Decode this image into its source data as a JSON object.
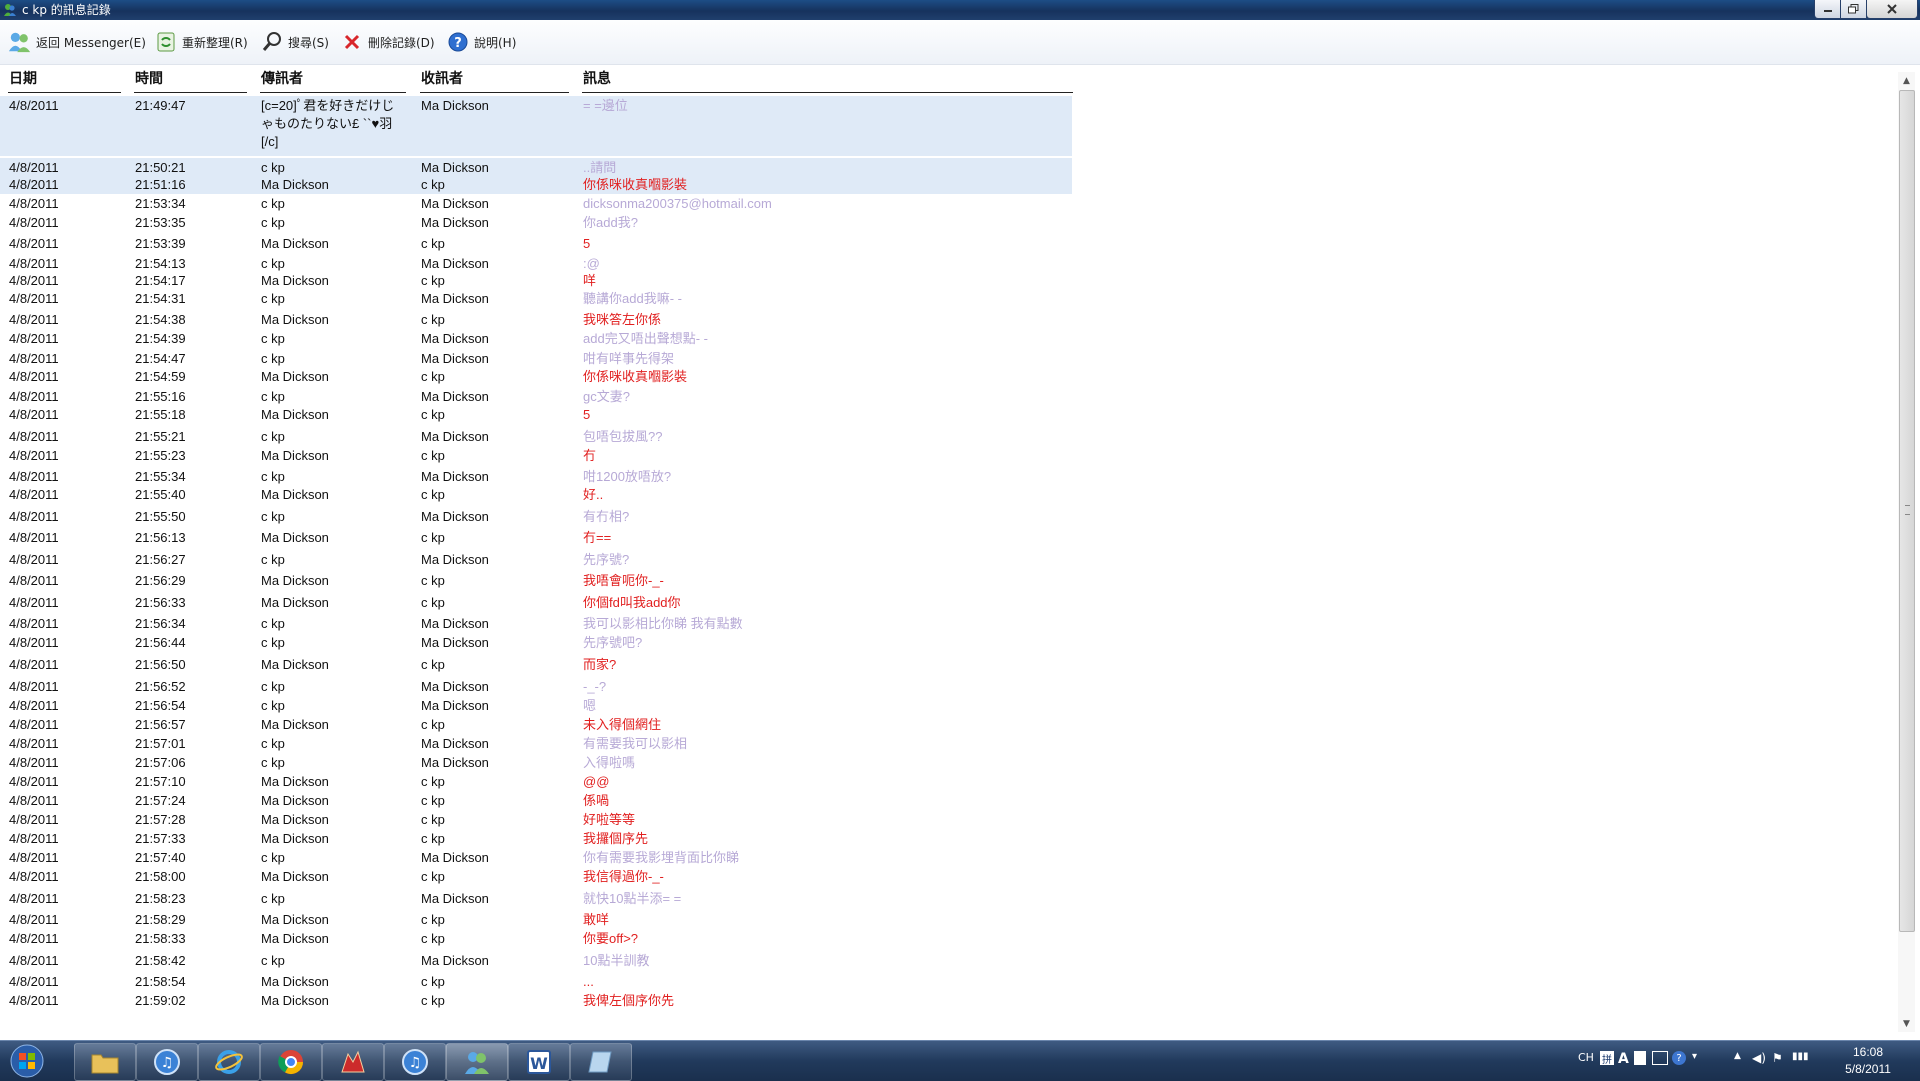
{
  "window": {
    "title": "c kp 的訊息記錄"
  },
  "toolbar": {
    "back_label": "返回 Messenger(E)",
    "refresh_label": "重新整理(R)",
    "search_label": "搜尋(S)",
    "delete_label": "刪除記錄(D)",
    "help_label": "說明(H)"
  },
  "columns": [
    "日期",
    "時間",
    "傳訊者",
    "收訊者",
    "訊息"
  ],
  "rows": [
    {
      "date": "4/8/2011",
      "time": "21:49:47",
      "from": "[c=20]ﾟ君を好きだけじゃものたりない£ ``♥羽[/c]",
      "to": "Ma Dickson",
      "msg": "= =邊位",
      "sel": true
    },
    {
      "date": "4/8/2011",
      "time": "21:50:21",
      "from": "c kp",
      "to": "Ma Dickson",
      "msg": "..請問",
      "sel": true
    },
    {
      "date": "4/8/2011",
      "time": "21:51:16",
      "from": "Ma Dickson",
      "to": "c kp",
      "msg": "你係咪收真嗰影裝",
      "sel": true
    },
    {
      "date": "4/8/2011",
      "time": "21:53:34",
      "from": "c kp",
      "to": "Ma Dickson",
      "msg": "dicksonma200375@hotmail.com"
    },
    {
      "date": "4/8/2011",
      "time": "21:53:35",
      "from": "c kp",
      "to": "Ma Dickson",
      "msg": "你add我?"
    },
    {
      "date": "4/8/2011",
      "time": "21:53:39",
      "from": "Ma Dickson",
      "to": "c kp",
      "msg": "5"
    },
    {
      "date": "4/8/2011",
      "time": "21:54:13",
      "from": "c kp",
      "to": "Ma Dickson",
      "msg": ":@"
    },
    {
      "date": "4/8/2011",
      "time": "21:54:17",
      "from": "Ma Dickson",
      "to": "c kp",
      "msg": "咩"
    },
    {
      "date": "4/8/2011",
      "time": "21:54:31",
      "from": "c kp",
      "to": "Ma Dickson",
      "msg": "聽講你add我嘛- -"
    },
    {
      "date": "4/8/2011",
      "time": "21:54:38",
      "from": "Ma Dickson",
      "to": "c kp",
      "msg": "我咪答左你係"
    },
    {
      "date": "4/8/2011",
      "time": "21:54:39",
      "from": "c kp",
      "to": "Ma Dickson",
      "msg": "add完又唔出聲想點- -"
    },
    {
      "date": "4/8/2011",
      "time": "21:54:47",
      "from": "c kp",
      "to": "Ma Dickson",
      "msg": "咁有咩事先得架"
    },
    {
      "date": "4/8/2011",
      "time": "21:54:59",
      "from": "Ma Dickson",
      "to": "c kp",
      "msg": "你係咪收真嗰影裝"
    },
    {
      "date": "4/8/2011",
      "time": "21:55:16",
      "from": "c kp",
      "to": "Ma Dickson",
      "msg": "gc文妻?"
    },
    {
      "date": "4/8/2011",
      "time": "21:55:18",
      "from": "Ma Dickson",
      "to": "c kp",
      "msg": "5"
    },
    {
      "date": "4/8/2011",
      "time": "21:55:21",
      "from": "c kp",
      "to": "Ma Dickson",
      "msg": "包唔包拔風??"
    },
    {
      "date": "4/8/2011",
      "time": "21:55:23",
      "from": "Ma Dickson",
      "to": "c kp",
      "msg": "冇"
    },
    {
      "date": "4/8/2011",
      "time": "21:55:34",
      "from": "c kp",
      "to": "Ma Dickson",
      "msg": "咁1200放唔放?"
    },
    {
      "date": "4/8/2011",
      "time": "21:55:40",
      "from": "Ma Dickson",
      "to": "c kp",
      "msg": "好.."
    },
    {
      "date": "4/8/2011",
      "time": "21:55:50",
      "from": "c kp",
      "to": "Ma Dickson",
      "msg": "有冇相?"
    },
    {
      "date": "4/8/2011",
      "time": "21:56:13",
      "from": "Ma Dickson",
      "to": "c kp",
      "msg": "冇=="
    },
    {
      "date": "4/8/2011",
      "time": "21:56:27",
      "from": "c kp",
      "to": "Ma Dickson",
      "msg": "先序號?"
    },
    {
      "date": "4/8/2011",
      "time": "21:56:29",
      "from": "Ma Dickson",
      "to": "c kp",
      "msg": "我唔會呃你-_-"
    },
    {
      "date": "4/8/2011",
      "time": "21:56:33",
      "from": "Ma Dickson",
      "to": "c kp",
      "msg": "你個fd叫我add你"
    },
    {
      "date": "4/8/2011",
      "time": "21:56:34",
      "from": "c kp",
      "to": "Ma Dickson",
      "msg": "我可以影相比你睇 我有點數"
    },
    {
      "date": "4/8/2011",
      "time": "21:56:44",
      "from": "c kp",
      "to": "Ma Dickson",
      "msg": "先序號吧?"
    },
    {
      "date": "4/8/2011",
      "time": "21:56:50",
      "from": "Ma Dickson",
      "to": "c kp",
      "msg": "而家?"
    },
    {
      "date": "4/8/2011",
      "time": "21:56:52",
      "from": "c kp",
      "to": "Ma Dickson",
      "msg": "-_-?"
    },
    {
      "date": "4/8/2011",
      "time": "21:56:54",
      "from": "c kp",
      "to": "Ma Dickson",
      "msg": "嗯"
    },
    {
      "date": "4/8/2011",
      "time": "21:56:57",
      "from": "Ma Dickson",
      "to": "c kp",
      "msg": "未入得個網住"
    },
    {
      "date": "4/8/2011",
      "time": "21:57:01",
      "from": "c kp",
      "to": "Ma Dickson",
      "msg": "有需要我可以影相"
    },
    {
      "date": "4/8/2011",
      "time": "21:57:06",
      "from": "c kp",
      "to": "Ma Dickson",
      "msg": "入得啦嗎"
    },
    {
      "date": "4/8/2011",
      "time": "21:57:10",
      "from": "Ma Dickson",
      "to": "c kp",
      "msg": "@@"
    },
    {
      "date": "4/8/2011",
      "time": "21:57:24",
      "from": "Ma Dickson",
      "to": "c kp",
      "msg": "係喎"
    },
    {
      "date": "4/8/2011",
      "time": "21:57:28",
      "from": "Ma Dickson",
      "to": "c kp",
      "msg": "好啦等等"
    },
    {
      "date": "4/8/2011",
      "time": "21:57:33",
      "from": "Ma Dickson",
      "to": "c kp",
      "msg": "我攞個序先"
    },
    {
      "date": "4/8/2011",
      "time": "21:57:40",
      "from": "c kp",
      "to": "Ma Dickson",
      "msg": "你有需要我影埋背面比你睇"
    },
    {
      "date": "4/8/2011",
      "time": "21:58:00",
      "from": "Ma Dickson",
      "to": "c kp",
      "msg": "我信得過你-_-"
    },
    {
      "date": "4/8/2011",
      "time": "21:58:23",
      "from": "c kp",
      "to": "Ma Dickson",
      "msg": "就快10點半添= ="
    },
    {
      "date": "4/8/2011",
      "time": "21:58:29",
      "from": "Ma Dickson",
      "to": "c kp",
      "msg": "敢咩"
    },
    {
      "date": "4/8/2011",
      "time": "21:58:33",
      "from": "Ma Dickson",
      "to": "c kp",
      "msg": "你要off>?"
    },
    {
      "date": "4/8/2011",
      "time": "21:58:42",
      "from": "c kp",
      "to": "Ma Dickson",
      "msg": "10點半訓教"
    },
    {
      "date": "4/8/2011",
      "time": "21:58:54",
      "from": "Ma Dickson",
      "to": "c kp",
      "msg": "..."
    },
    {
      "date": "4/8/2011",
      "time": "21:59:02",
      "from": "Ma Dickson",
      "to": "c kp",
      "msg": "我俾左個序你先"
    }
  ],
  "colors": {
    "sender_ckp_msg": "#b7a9d6",
    "sender_ma_msg": "#e12020",
    "selection": "#dfeaf7"
  },
  "taskbar": {
    "apps": [
      "windows-explorer",
      "itunes",
      "internet-explorer",
      "chrome",
      "firefox-like-red",
      "itunes-2",
      "messenger",
      "word",
      "notepad"
    ],
    "tray_lang": "CH",
    "clock_time": "16:08",
    "clock_date": "5/8/2011"
  }
}
